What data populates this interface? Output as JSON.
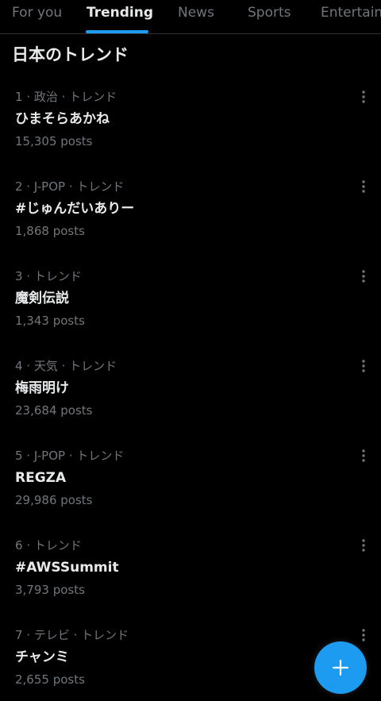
{
  "tabs": [
    {
      "label": "For you",
      "active": false
    },
    {
      "label": "Trending",
      "active": true
    },
    {
      "label": "News",
      "active": false
    },
    {
      "label": "Sports",
      "active": false
    },
    {
      "label": "Entertainment",
      "active": false
    }
  ],
  "section_title": "日本のトレンド",
  "trends": [
    {
      "meta": "1 · 政治 · トレンド",
      "name": "ひまそらあかね",
      "posts": "15,305 posts"
    },
    {
      "meta": "2 · J-POP · トレンド",
      "name": "#じゅんだいありー",
      "posts": "1,868 posts"
    },
    {
      "meta": "3 · トレンド",
      "name": "魔剣伝説",
      "posts": "1,343 posts"
    },
    {
      "meta": "4 · 天気 · トレンド",
      "name": "梅雨明け",
      "posts": "23,684 posts"
    },
    {
      "meta": "5 · J-POP · トレンド",
      "name": "REGZA",
      "posts": "29,986 posts"
    },
    {
      "meta": "6 · トレンド",
      "name": "#AWSSummit",
      "posts": "3,793 posts"
    },
    {
      "meta": "7 · テレビ · トレンド",
      "name": "チャンミ",
      "posts": "2,655 posts"
    }
  ],
  "icons": {
    "more": "more-vertical-icon",
    "compose": "plus-icon"
  },
  "colors": {
    "background": "#000000",
    "accent": "#1d9bf0",
    "primary_text": "#e7e9ea",
    "secondary_text": "#71767b"
  }
}
